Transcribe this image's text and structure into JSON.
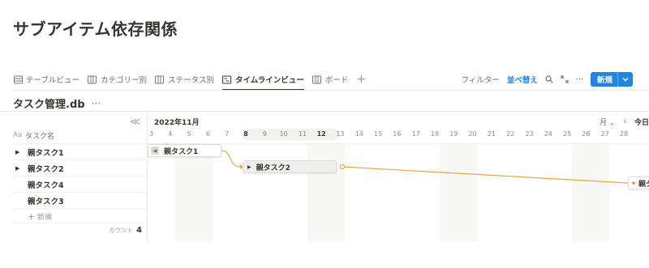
{
  "page": {
    "title": "サブアイテム依存関係"
  },
  "views": {
    "tabs": [
      {
        "label": "テーブルビュー",
        "icon": "table-icon",
        "active": false
      },
      {
        "label": "カテゴリー別",
        "icon": "board-icon",
        "active": false
      },
      {
        "label": "ステータス別",
        "icon": "board-icon",
        "active": false
      },
      {
        "label": "タイムラインビュー",
        "icon": "timeline-icon",
        "active": true
      },
      {
        "label": "ボード",
        "icon": "board-icon",
        "active": false
      }
    ],
    "add_label": "+"
  },
  "toolbar": {
    "filter_label": "フィルター",
    "sort_label": "並べ替え",
    "more_label": "···",
    "new_label": "新規",
    "new_dropdown": "⌄"
  },
  "database": {
    "title": "タスク管理.db",
    "more": "···"
  },
  "table": {
    "column_prefix": "Aa",
    "column_name": "タスク名",
    "rows": [
      {
        "name": "親タスク1",
        "expandable": true
      },
      {
        "name": "親タスク2",
        "expandable": true
      },
      {
        "name": "親タスク4",
        "expandable": false
      },
      {
        "name": "親タスク3",
        "expandable": false
      }
    ],
    "add_row_label": "新規",
    "count_label": "カウント",
    "count_value": "4",
    "collapse_label": "≪"
  },
  "timeline": {
    "month_label": "2022年11月",
    "scale_label": "月",
    "scale_chevron": "⌄",
    "prev_label": "‹",
    "today_label": "今日",
    "days": [
      "3",
      "4",
      "5",
      "6",
      "7",
      "8",
      "9",
      "10",
      "11",
      "12",
      "13",
      "14",
      "15",
      "16",
      "17",
      "18",
      "19",
      "20",
      "21",
      "22",
      "23",
      "24",
      "25",
      "26",
      "27",
      "28"
    ],
    "highlight_days": [
      "8",
      "12"
    ],
    "bars": [
      {
        "label": "親タスク1"
      },
      {
        "label": "親タスク2"
      },
      {
        "label": "親タス"
      }
    ],
    "colors": {
      "dependency": "#e8a838",
      "accent": "#2383e2"
    }
  }
}
